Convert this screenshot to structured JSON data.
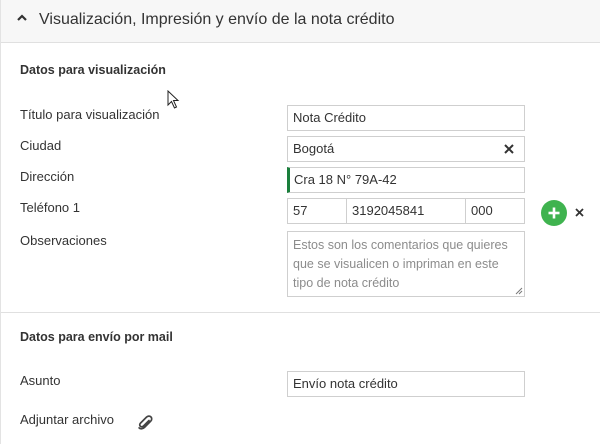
{
  "header": {
    "title": "Visualización, Impresión y envío de la nota crédito"
  },
  "display_section": {
    "title": "Datos para visualización",
    "fields": {
      "titulo": {
        "label": "Título para visualización",
        "value": "Nota Crédito"
      },
      "ciudad": {
        "label": "Ciudad",
        "value": "Bogotá"
      },
      "direccion": {
        "label": "Dirección",
        "value": "Cra 18 N° 79A-42"
      },
      "telefono": {
        "label": "Teléfono 1",
        "code": "57",
        "number": "3192045841",
        "ext": "000"
      },
      "observaciones": {
        "label": "Observaciones",
        "placeholder": "Estos son los comentarios que quieres que se visualicen o impriman en este tipo de nota crédito"
      }
    }
  },
  "mail_section": {
    "title": "Datos para envío por mail",
    "fields": {
      "asunto": {
        "label": "Asunto",
        "value": "Envío nota crédito"
      },
      "adjuntar": {
        "label": "Adjuntar archivo"
      }
    }
  },
  "colors": {
    "accent_green": "#3fb34f",
    "focus_green": "#1a7f3c"
  }
}
